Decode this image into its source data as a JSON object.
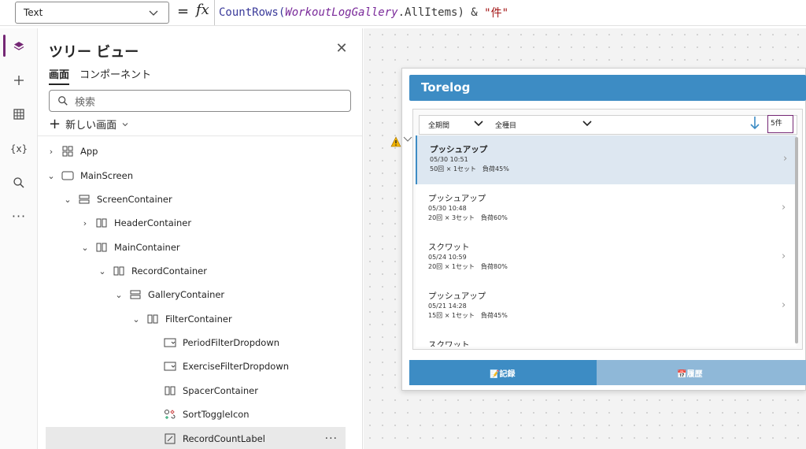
{
  "formula_bar": {
    "property": "Text",
    "equals": "=",
    "fx": "fx",
    "formula_fn": "CountRows(",
    "formula_ref": "WorkoutLogGallery",
    "formula_rest": ".AllItems) & ",
    "formula_str": "\"件\""
  },
  "tree": {
    "title": "ツリー ビュー",
    "tabs": [
      "画面",
      "コンポーネント"
    ],
    "search_placeholder": "検索",
    "new_screen": "新しい画面",
    "nodes": [
      {
        "label": "App",
        "icon": "app-icon",
        "toggle": "›"
      },
      {
        "label": "MainScreen",
        "icon": "screen-icon",
        "toggle": "⌄"
      },
      {
        "label": "ScreenContainer",
        "icon": "vertical-container-icon",
        "toggle": "⌄"
      },
      {
        "label": "HeaderContainer",
        "icon": "horizontal-container-icon",
        "toggle": "›"
      },
      {
        "label": "MainContainer",
        "icon": "horizontal-container-icon",
        "toggle": "⌄"
      },
      {
        "label": "RecordContainer",
        "icon": "horizontal-container-icon",
        "toggle": "⌄"
      },
      {
        "label": "GalleryContainer",
        "icon": "vertical-container-icon",
        "toggle": "⌄"
      },
      {
        "label": "FilterContainer",
        "icon": "horizontal-container-icon",
        "toggle": "⌄"
      },
      {
        "label": "PeriodFilterDropdown",
        "icon": "dropdown-icon",
        "toggle": ""
      },
      {
        "label": "ExerciseFilterDropdown",
        "icon": "dropdown-icon",
        "toggle": ""
      },
      {
        "label": "SpacerContainer",
        "icon": "horizontal-container-icon",
        "toggle": ""
      },
      {
        "label": "SortToggleIcon",
        "icon": "icon-control-icon",
        "toggle": ""
      },
      {
        "label": "RecordCountLabel",
        "icon": "label-icon",
        "toggle": ""
      }
    ],
    "more": "···"
  },
  "app": {
    "title": "Torelog",
    "period_filter": "全期間",
    "exercise_filter": "全種目",
    "count": "5件",
    "records": [
      {
        "title": "プッシュアップ",
        "date": "05/30 10:51",
        "detail": "50回 × 1セット　負荷45%"
      },
      {
        "title": "プッシュアップ",
        "date": "05/30 10:48",
        "detail": "20回 × 3セット　負荷60%"
      },
      {
        "title": "スクワット",
        "date": "05/24 10:59",
        "detail": "20回 × 1セット　負荷80%"
      },
      {
        "title": "プッシュアップ",
        "date": "05/21 14:28",
        "detail": "15回 × 1セット　負荷45%"
      },
      {
        "title": "スクワット",
        "date": "",
        "detail": ""
      }
    ],
    "tab_record": "📝記録",
    "tab_history": "📅履歴"
  },
  "colors": {
    "accent": "#742774",
    "app_blue": "#3d8cc4",
    "app_blue_light": "#8fb8d8"
  }
}
